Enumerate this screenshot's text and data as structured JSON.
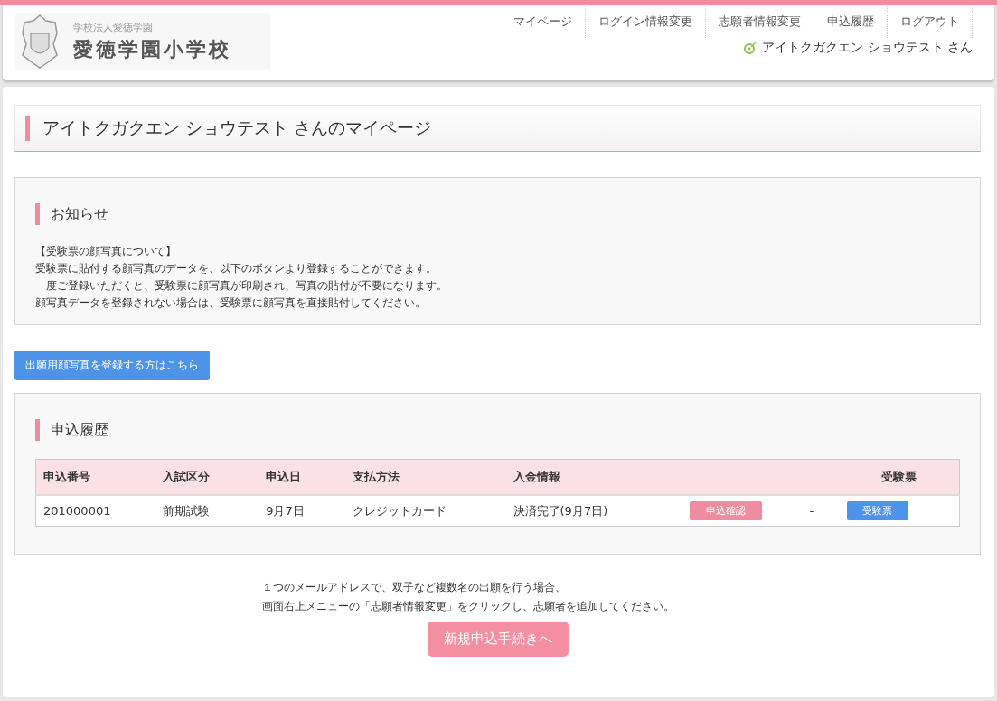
{
  "header": {
    "org": "学校法人愛徳学園",
    "school": "愛徳学園小学校",
    "nav": [
      {
        "label": "マイページ"
      },
      {
        "label": "ログイン情報変更"
      },
      {
        "label": "志願者情報変更"
      },
      {
        "label": "申込履歴"
      },
      {
        "label": "ログアウト"
      }
    ],
    "user": "アイトクガクエン ショウテスト さん"
  },
  "page_title": "アイトクガクエン ショウテスト さんのマイページ",
  "notice": {
    "heading": "お知らせ",
    "lines": [
      "【受験票の顔写真について】",
      "受験票に貼付する顔写真のデータを、以下のボタンより登録することができます。",
      "一度ご登録いただくと、受験票に顔写真が印刷され、写真の貼付が不要になります。",
      "顔写真データを登録されない場合は、受験票に顔写真を直接貼付してください。"
    ]
  },
  "photo_button": "出願用顔写真を登録する方はこちら",
  "history": {
    "heading": "申込履歴",
    "columns": [
      "申込番号",
      "入試区分",
      "申込日",
      "支払方法",
      "入金情報",
      "",
      "",
      "受験票"
    ],
    "rows": [
      {
        "cells": [
          {
            "kind": "text",
            "text": "201000001"
          },
          {
            "kind": "text",
            "text": "前期試験"
          },
          {
            "kind": "text",
            "text": "9月7日"
          },
          {
            "kind": "text",
            "text": "クレジットカード"
          },
          {
            "kind": "text",
            "text": "決済完了(9月7日)"
          },
          {
            "kind": "pink-button",
            "text": "申込確認"
          },
          {
            "kind": "text",
            "text": "-"
          },
          {
            "kind": "blue-button",
            "text": "受験票"
          }
        ]
      }
    ]
  },
  "note_lines": [
    "１つのメールアドレスで、双子など複数名の出願を行う場合、",
    "画面右上メニューの「志願者情報変更」をクリックし、志願者を追加してください。"
  ],
  "new_button": "新規申込手続きへ"
}
